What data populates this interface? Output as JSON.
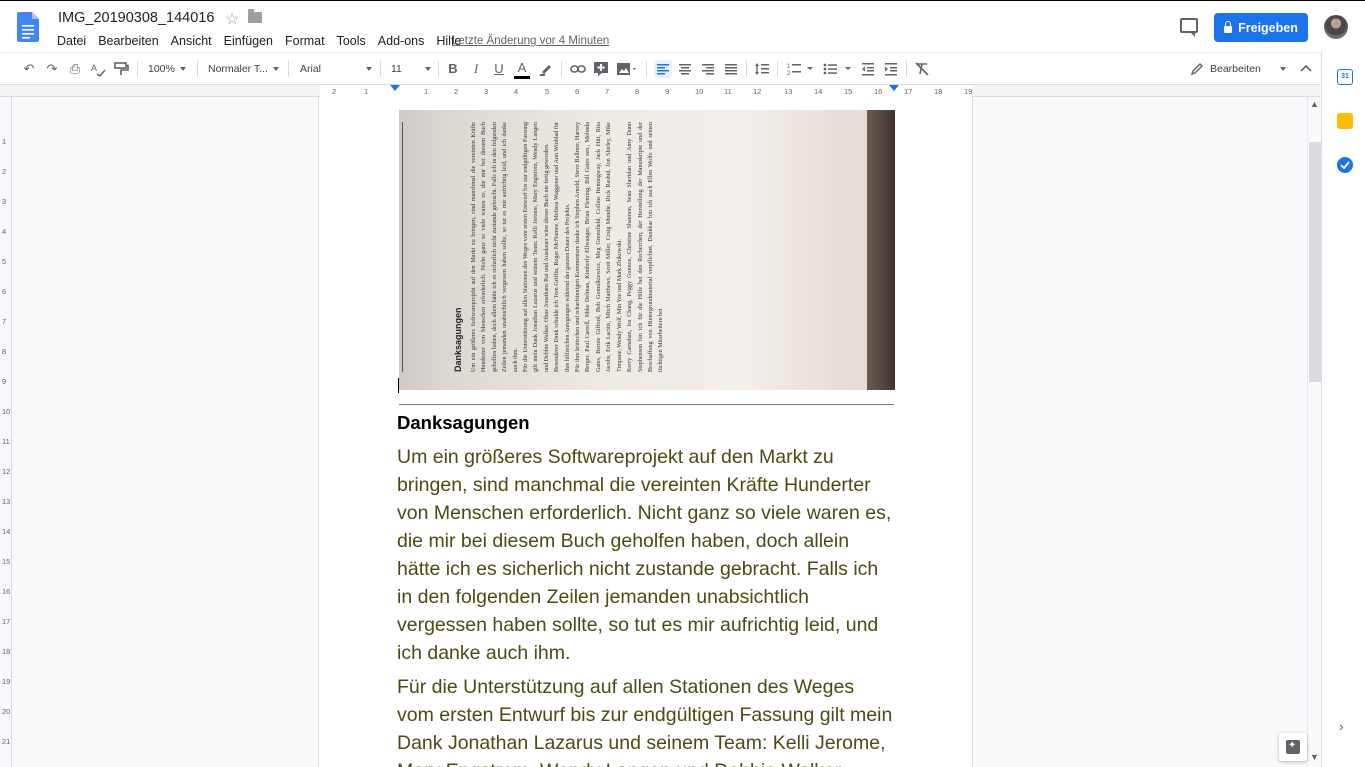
{
  "header": {
    "title": "IMG_20190308_144016",
    "menu": [
      "Datei",
      "Bearbeiten",
      "Ansicht",
      "Einfügen",
      "Format",
      "Tools",
      "Add-ons",
      "Hilfe"
    ],
    "last_edit": "Letzte Änderung vor 4 Minuten",
    "share_label": "Freigeben",
    "icons": [
      "docs-icon",
      "star-icon",
      "folder-icon",
      "comment-icon",
      "lock-icon",
      "avatar"
    ]
  },
  "toolbar": {
    "zoom": "100%",
    "style": "Normaler T...",
    "font": "Arial",
    "size": "11",
    "mode": "Bearbeiten",
    "undo": "↶",
    "redo": "↷",
    "print": "⎙",
    "bold": "B",
    "italic": "I",
    "underline": "U",
    "text_color": "A",
    "accent_color": "#1a73e8",
    "share_color": "#1a73e8"
  },
  "ruler": {
    "h_ticks": [
      "2",
      "1",
      "1",
      "2",
      "3",
      "4",
      "5",
      "6",
      "7",
      "8",
      "9",
      "10",
      "11",
      "12",
      "13",
      "14",
      "15",
      "16",
      "17",
      "18",
      "19"
    ],
    "v_ticks": [
      "1",
      "2",
      "3",
      "4",
      "5",
      "6",
      "7",
      "8",
      "9",
      "10",
      "11",
      "12",
      "13",
      "14",
      "15",
      "16",
      "17",
      "18",
      "19",
      "20",
      "21"
    ]
  },
  "scan": {
    "heading": "Danksagungen",
    "lines": [
      "Um ein größeres Softwareprojekt auf den Markt zu bringen, sind manchmal die vereinten Kräfte Hunderter von Menschen erforderlich. Nicht ganz so viele waren es, die mir bei diesem Buch geholfen haben, doch allein hätte ich es sicherlich nicht zustande gebracht. Falls ich in den folgenden Zeilen jemanden unabsichtlich vergessen haben sollte, so tut es mir aufrichtig leid, und ich danke auch ihm.",
      "Für die Unterstützung auf allen Stationen des Weges vom ersten Entwurf bis zur endgültigen Fassung gilt mein Dank Jonathan Lazarus und seinem Team: Kelli Jerome, Mary Engstrom, Wendy Langen und Debbie Walker. Ohne Jonathans Rat und Ausdauer wäre dieses Buch nie fertig geworden.",
      "Besonderer Dank schulde ich Tren Griffin, Roger McNamee, Melissa Waggener und Ann Winblad für ihre hilfreichen Anregungen während der ganzen Dauer des Projekts.",
      "Für ihre kritischen und scharfsinnigen Kommentare danke ich Stephen Arnold, Steve Ballmer, Harvey Berger, Paul Carroll, Mike Delman, Kimberly Ellwanger, Brian Fleming, Bill Gates sen., Melinda Gates, Bernie Gifford, Bob Gomulkiewicz, Meg Greenfield, Collins Hemingway, Jack Hitt, Rita Jacobs, Erik Lacitis, Mitch Matthews, Scott Miller, Craig Mundie, Rick Rashid, Jon Shirley, Mike Timpane, Wendy Wolf, Min Yee und Mark Zbikowski.",
      "Kerry Carnahan, Ira Chang, Peggy Gunnoe, Christine Shannon, Sean Sheridan und Amy Dunn Stephenson bin ich für die Hilfe bei den Recherchen, der Herstellung der Manuskripte und der Beschaffung von Hintergrundmaterial verpflichtet. Dankbar bin ich auch Ellen Wolfe und seinen tüchtigen Mitarbeitern bei"
    ]
  },
  "document": {
    "heading": "Danksagungen",
    "paragraphs": [
      "Um ein größeres Softwareprojekt auf den Markt zu bringen, sind manchmal die vereinten Kräfte Hunderter von Menschen erforderlich. Nicht ganz so viele waren es, die mir bei diesem Buch geholfen haben, doch allein hätte ich es sicherlich nicht zustande gebracht. Falls ich in den folgenden Zeilen jemanden unabsichtlich vergessen haben sollte, so tut es mir aufrichtig leid, und ich danke auch ihm.",
      "Für die Unterstützung auf allen Stationen des Weges vom ersten Entwurf bis zur endgültigen Fassung gilt mein Dank Jonathan Lazarus und seinem Team: Kelli Jerome, Mary Engstrom, Wendy Langen und Debbie Walker."
    ],
    "body_color": "#4d4a12"
  },
  "sidepanel": {
    "icons": [
      "calendar-icon",
      "keep-icon",
      "tasks-icon",
      "explore-icon",
      "chevron-right-icon"
    ],
    "calendar_day": "31"
  }
}
